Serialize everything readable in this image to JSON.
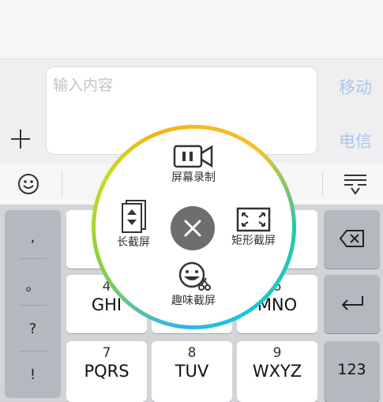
{
  "composer": {
    "input_placeholder": "输入内容",
    "carrier_1": "移动",
    "carrier_2": "电信"
  },
  "keyboard": {
    "symbols": [
      ",",
      "。",
      "?",
      "!"
    ],
    "keys": [
      {
        "num": "4",
        "letters": "GHI"
      },
      {
        "num": "6",
        "letters": "MNO"
      },
      {
        "num": "7",
        "letters": "PQRS"
      },
      {
        "num": "8",
        "letters": "TUV"
      },
      {
        "num": "9",
        "letters": "WXYZ"
      }
    ],
    "key_123": "123"
  },
  "screenshot_menu": {
    "options": {
      "screen_record": "屏幕录制",
      "long_screenshot": "长截屏",
      "rect_screenshot": "矩形截屏",
      "fun_screenshot": "趣味截屏"
    }
  },
  "colors": {
    "carrier_text": "#a9c6ee",
    "ring_gradient": [
      "#f6b21c",
      "#25c8a4",
      "#35b4ea",
      "#8fd23b"
    ]
  }
}
